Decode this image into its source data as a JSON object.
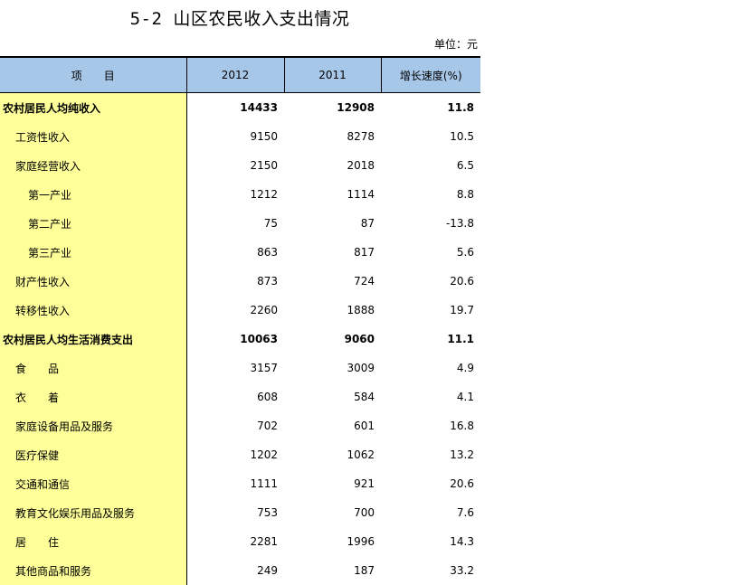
{
  "title": "5-2  山区农民收入支出情况",
  "unit": "单位：元",
  "headers": [
    "项　　目",
    "2012",
    "2011",
    "增长速度(%)"
  ],
  "rows": [
    {
      "label": "农村居民人均纯收入",
      "v2012": "14433",
      "v2011": "12908",
      "growth": "11.8",
      "bold": true,
      "indent": 0
    },
    {
      "label": "工资性收入",
      "v2012": "9150",
      "v2011": "8278",
      "growth": "10.5",
      "bold": false,
      "indent": 1
    },
    {
      "label": "家庭经营收入",
      "v2012": "2150",
      "v2011": "2018",
      "growth": "6.5",
      "bold": false,
      "indent": 1
    },
    {
      "label": "第一产业",
      "v2012": "1212",
      "v2011": "1114",
      "growth": "8.8",
      "bold": false,
      "indent": 2
    },
    {
      "label": "第二产业",
      "v2012": "75",
      "v2011": "87",
      "growth": "-13.8",
      "bold": false,
      "indent": 2
    },
    {
      "label": "第三产业",
      "v2012": "863",
      "v2011": "817",
      "growth": "5.6",
      "bold": false,
      "indent": 2
    },
    {
      "label": "财产性收入",
      "v2012": "873",
      "v2011": "724",
      "growth": "20.6",
      "bold": false,
      "indent": 1
    },
    {
      "label": "转移性收入",
      "v2012": "2260",
      "v2011": "1888",
      "growth": "19.7",
      "bold": false,
      "indent": 1
    },
    {
      "label": "农村居民人均生活消费支出",
      "v2012": "10063",
      "v2011": "9060",
      "growth": "11.1",
      "bold": true,
      "indent": 0
    },
    {
      "label": "食　　品",
      "v2012": "3157",
      "v2011": "3009",
      "growth": "4.9",
      "bold": false,
      "indent": 1
    },
    {
      "label": "衣　　着",
      "v2012": "608",
      "v2011": "584",
      "growth": "4.1",
      "bold": false,
      "indent": 1
    },
    {
      "label": "家庭设备用品及服务",
      "v2012": "702",
      "v2011": "601",
      "growth": "16.8",
      "bold": false,
      "indent": 1
    },
    {
      "label": "医疗保健",
      "v2012": "1202",
      "v2011": "1062",
      "growth": "13.2",
      "bold": false,
      "indent": 1
    },
    {
      "label": "交通和通信",
      "v2012": "1111",
      "v2011": "921",
      "growth": "20.6",
      "bold": false,
      "indent": 1
    },
    {
      "label": "教育文化娱乐用品及服务",
      "v2012": "753",
      "v2011": "700",
      "growth": "7.6",
      "bold": false,
      "indent": 1
    },
    {
      "label": "居　　住",
      "v2012": "2281",
      "v2011": "1996",
      "growth": "14.3",
      "bold": false,
      "indent": 1
    },
    {
      "label": "其他商品和服务",
      "v2012": "249",
      "v2011": "187",
      "growth": "33.2",
      "bold": false,
      "indent": 1
    }
  ],
  "colors": {
    "header_bg": "#a7c7e8",
    "label_bg": "#ffff99"
  }
}
